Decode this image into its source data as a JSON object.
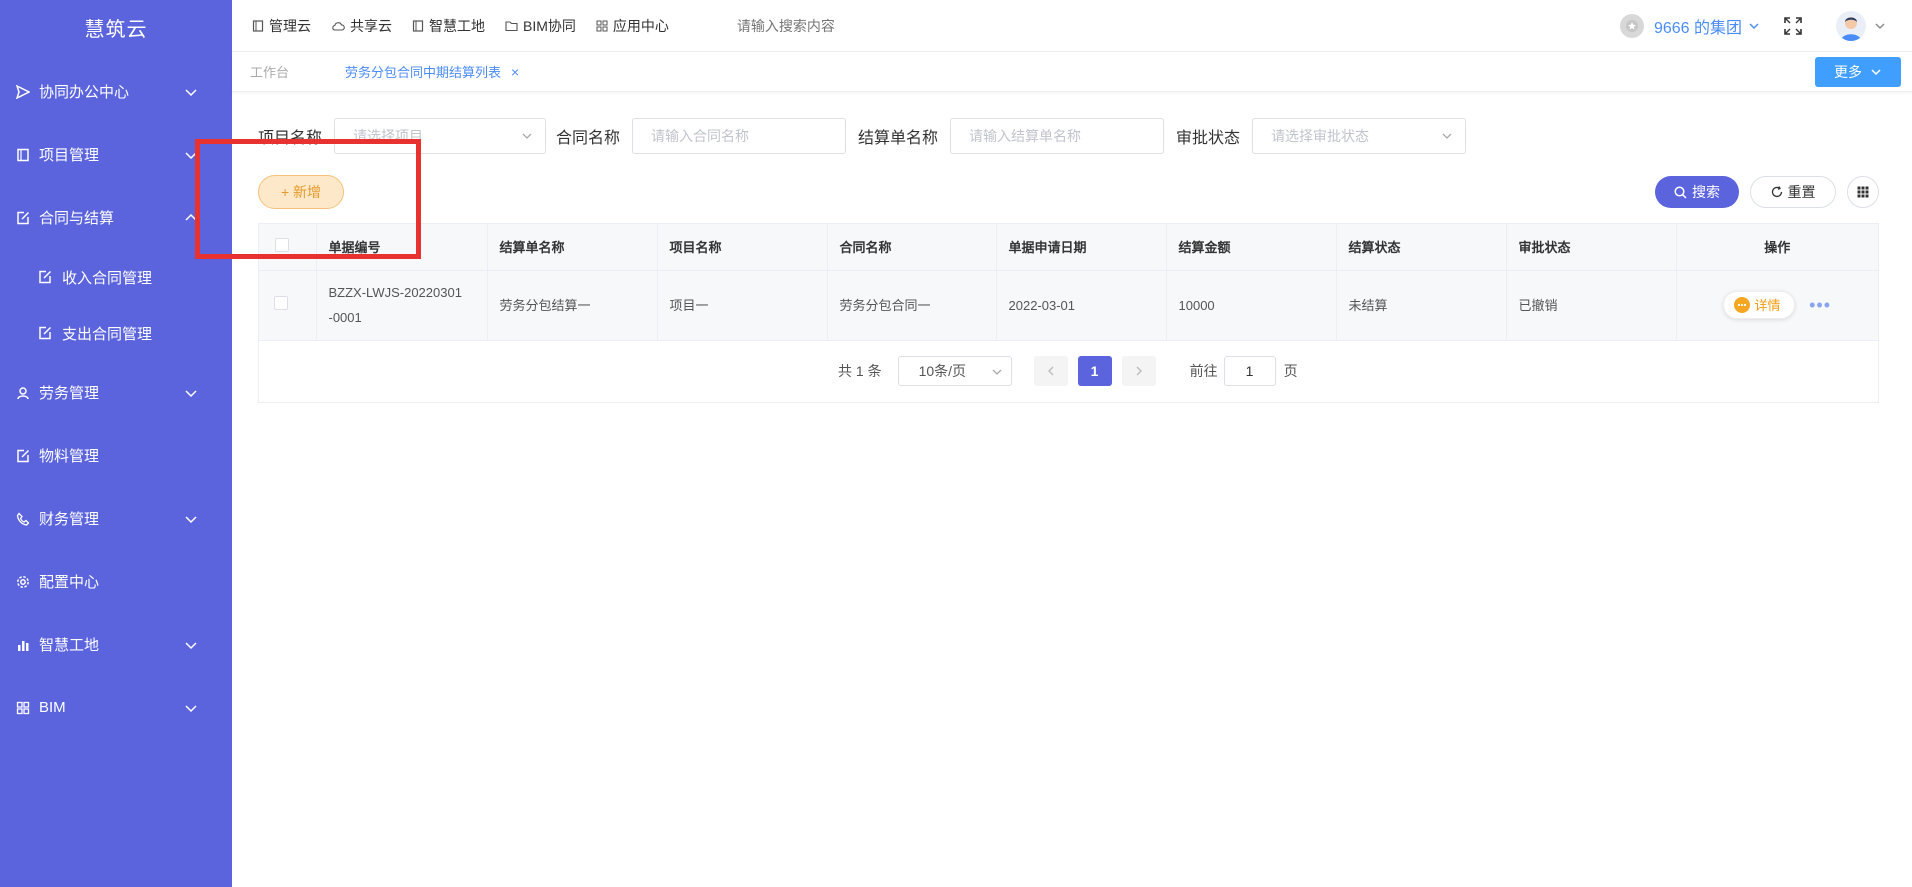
{
  "brand": "慧筑云",
  "sidebar": {
    "items": [
      {
        "label": "协同办公中心",
        "icon": "send-icon",
        "chevron": "down"
      },
      {
        "label": "项目管理",
        "icon": "book-icon",
        "chevron": "down"
      },
      {
        "label": "合同与结算",
        "icon": "edit-doc-icon",
        "chevron": "up"
      },
      {
        "label": "劳务管理",
        "icon": "worker-icon",
        "chevron": "down"
      },
      {
        "label": "物料管理",
        "icon": "edit-doc-icon",
        "chevron": "none"
      },
      {
        "label": "财务管理",
        "icon": "phone-icon",
        "chevron": "down"
      },
      {
        "label": "配置中心",
        "icon": "gear-icon",
        "chevron": "none"
      },
      {
        "label": "智慧工地",
        "icon": "bar-chart-icon",
        "chevron": "down"
      },
      {
        "label": "BIM",
        "icon": "grid-icon",
        "chevron": "down"
      }
    ],
    "subitems": [
      {
        "label": "收入合同管理",
        "icon": "edit-doc-icon"
      },
      {
        "label": "支出合同管理",
        "icon": "edit-doc-icon"
      }
    ]
  },
  "topnav": {
    "items": [
      {
        "label": "管理云",
        "icon": "book-icon"
      },
      {
        "label": "共享云",
        "icon": "cloud-icon"
      },
      {
        "label": "智慧工地",
        "icon": "book-icon"
      },
      {
        "label": "BIM协同",
        "icon": "folder-icon"
      },
      {
        "label": "应用中心",
        "icon": "grid-icon"
      }
    ],
    "search_placeholder": "请输入搜索内容",
    "org": "9666 的集团"
  },
  "tabs": {
    "home": "工作台",
    "active": "劳务分包合同中期结算列表",
    "close": "×",
    "more": "更多"
  },
  "filters": {
    "project_label": "项目名称",
    "project_placeholder": "请选择项目",
    "contract_label": "合同名称",
    "contract_placeholder": "请输入合同名称",
    "settle_label": "结算单名称",
    "settle_placeholder": "请输入结算单名称",
    "approval_label": "审批状态",
    "approval_placeholder": "请选择审批状态"
  },
  "toolbar": {
    "add": "+ 新增",
    "search": "搜索",
    "reset": "重置"
  },
  "table": {
    "headers": [
      "单据编号",
      "结算单名称",
      "项目名称",
      "合同名称",
      "单据申请日期",
      "结算金额",
      "结算状态",
      "审批状态",
      "操作"
    ],
    "rows": [
      {
        "doc_no_1": "BZZX-LWJS-20220301",
        "doc_no_2": "-0001",
        "settle_name": "劳务分包结算一",
        "project": "项目一",
        "contract": "劳务分包合同一",
        "date": "2022-03-01",
        "amount": "10000",
        "settle_status": "未结算",
        "approval_status": "已撤销",
        "detail": "详情",
        "more": "•••"
      }
    ]
  },
  "pager": {
    "total": "共 1 条",
    "page_size": "10条/页",
    "current": "1",
    "goto_prefix": "前往",
    "goto_value": "1",
    "goto_suffix": "页"
  },
  "colors": {
    "sidebar": "#5b63dd",
    "accent": "#409eff",
    "highlight": "#e8322f"
  }
}
